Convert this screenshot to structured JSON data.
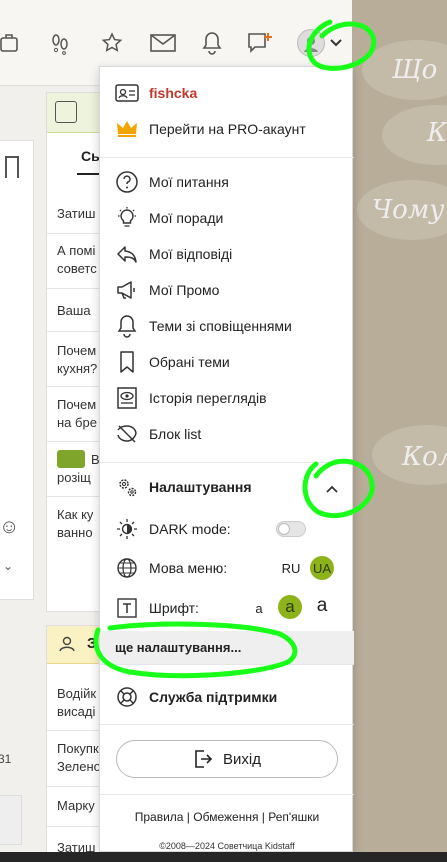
{
  "background": {
    "texts": [
      "Що",
      "К",
      "Чому",
      "Кол"
    ]
  },
  "left_panel": {
    "top_tab": "Сь",
    "rows": [
      "Затиш",
      "А помі",
      "советс",
      "Ваша",
      "Почем",
      "кухня?",
      "Почем",
      "на бре",
      "В",
      "розіщ",
      "Как ку",
      "ванно"
    ],
    "section2_title": "З",
    "rows2": [
      "Водійк",
      "висадi",
      "Покупк",
      "Зелено",
      "Марку",
      "Затиш"
    ],
    "badge_number": "31"
  },
  "menu": {
    "username": "fishcka",
    "pro_link": "Перейти на PRO-акаунт",
    "items": [
      {
        "label": "Мої питання",
        "icon": "question-circle-icon"
      },
      {
        "label": "Мої поради",
        "icon": "lightbulb-icon"
      },
      {
        "label": "Мої відповіді",
        "icon": "reply-arrow-icon"
      },
      {
        "label": "Мої Промо",
        "icon": "megaphone-icon"
      },
      {
        "label": "Теми зі сповіщеннями",
        "icon": "bell-icon"
      },
      {
        "label": "Обрані теми",
        "icon": "bookmark-icon"
      },
      {
        "label": "Історія переглядів",
        "icon": "history-eye-icon"
      },
      {
        "label": "Блок list",
        "icon": "block-icon"
      }
    ],
    "settings_label": "Налаштування",
    "dark_mode_label": "DARK mode:",
    "dark_mode_on": false,
    "menu_lang_label": "Мова меню:",
    "lang_options": [
      "RU",
      "UA"
    ],
    "lang_selected": "UA",
    "font_label": "Шрифт:",
    "font_options": [
      "a",
      "a",
      "a"
    ],
    "font_selected_index": 1,
    "more_settings": "ще налаштування...",
    "support": "Служба підтримки",
    "logout": "Вихід",
    "footer_links": "Правила | Обмеження | Реп'яшки",
    "copyright": "©2008—2024 Советчица Kidstaff"
  },
  "colors": {
    "username": "#c0392b",
    "accent_green": "#8cb31a",
    "annotation_green": "#19ff19",
    "crown": "#f0a500"
  }
}
